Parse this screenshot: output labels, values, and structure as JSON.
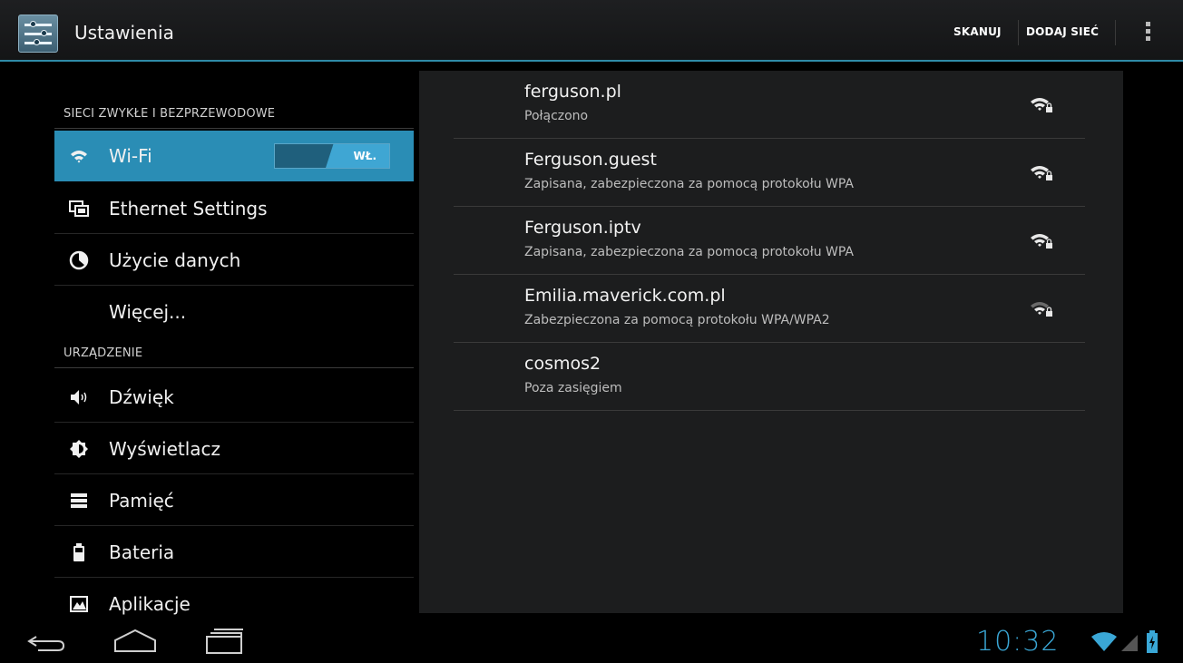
{
  "actionbar": {
    "title": "Ustawienia",
    "scan_label": "SKANUJ",
    "add_network_label": "DODAJ SIEĆ"
  },
  "sidebar": {
    "section1_header": "SIECI ZWYKŁE I BEZPRZEWODOWE",
    "section2_header": "URZĄDZENIE",
    "items": [
      {
        "label": "Wi-Fi",
        "icon": "wifi-icon"
      },
      {
        "label": "Ethernet Settings",
        "icon": "ethernet-icon"
      },
      {
        "label": "Użycie danych",
        "icon": "data-usage-icon"
      },
      {
        "label": "Więcej...",
        "icon": ""
      },
      {
        "label": "Dźwięk",
        "icon": "speaker-icon"
      },
      {
        "label": "Wyświetlacz",
        "icon": "display-icon"
      },
      {
        "label": "Pamięć",
        "icon": "storage-icon"
      },
      {
        "label": "Bateria",
        "icon": "battery-icon"
      },
      {
        "label": "Aplikacje",
        "icon": "apps-icon"
      }
    ],
    "wifi_toggle": "WŁ."
  },
  "networks": [
    {
      "name": "ferguson.pl",
      "status": "Połączono",
      "strength": "strong"
    },
    {
      "name": "Ferguson.guest",
      "status": "Zapisana, zabezpieczona za pomocą protokołu WPA",
      "strength": "strong"
    },
    {
      "name": "Ferguson.iptv",
      "status": "Zapisana, zabezpieczona za pomocą protokołu WPA",
      "strength": "strong"
    },
    {
      "name": "Emilia.maverick.com.pl",
      "status": "Zabezpieczona za pomocą protokołu WPA/WPA2",
      "strength": "weak"
    },
    {
      "name": "cosmos2",
      "status": "Poza zasięgiem",
      "strength": "none"
    }
  ],
  "statusbar": {
    "time": "10:32"
  },
  "colors": {
    "accent": "#33b5e5",
    "selected": "#2a8db5"
  }
}
